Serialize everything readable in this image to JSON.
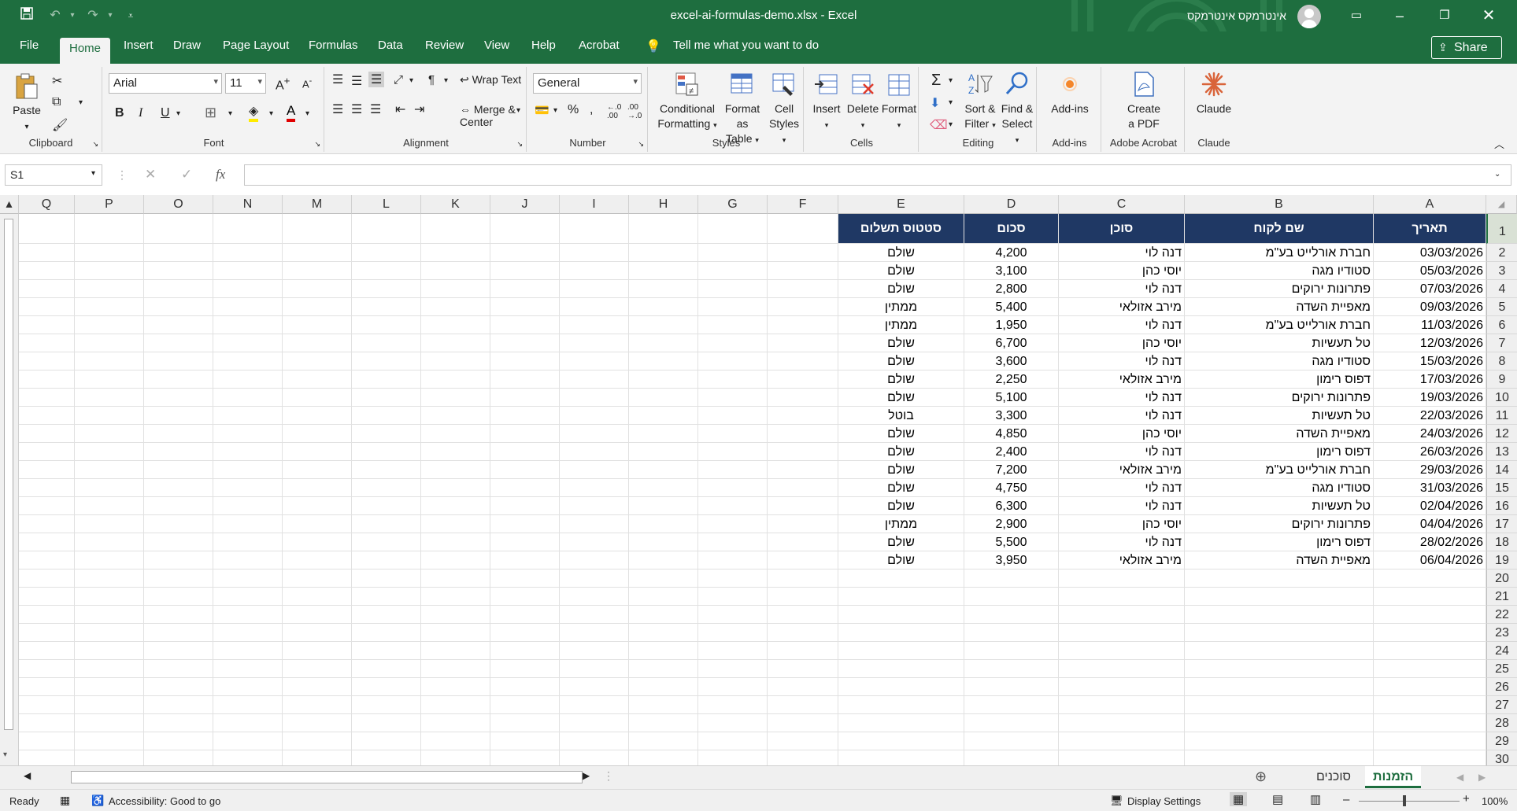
{
  "window": {
    "title": "excel-ai-formulas-demo.xlsx  -  Excel",
    "user": "אינטרמקס אינטרמקס"
  },
  "menu": {
    "file": "File",
    "home": "Home",
    "insert": "Insert",
    "draw": "Draw",
    "page_layout": "Page Layout",
    "formulas": "Formulas",
    "data": "Data",
    "review": "Review",
    "view": "View",
    "help": "Help",
    "acrobat": "Acrobat",
    "tell_me": "Tell me what you want to do",
    "share": "Share"
  },
  "ribbon": {
    "clipboard": {
      "label": "Clipboard",
      "paste": "Paste"
    },
    "font": {
      "label": "Font",
      "name": "Arial",
      "size": "11",
      "bold": "B",
      "italic": "I",
      "underline": "U"
    },
    "alignment": {
      "label": "Alignment",
      "wrap": "Wrap Text",
      "merge": "Merge & Center"
    },
    "number": {
      "label": "Number",
      "format": "General"
    },
    "styles": {
      "label": "Styles",
      "conditional_1": "Conditional",
      "conditional_2": "Formatting",
      "format_table_1": "Format as",
      "format_table_2": "Table",
      "cell_styles_1": "Cell",
      "cell_styles_2": "Styles"
    },
    "cells": {
      "label": "Cells",
      "insert": "Insert",
      "delete": "Delete",
      "format": "Format"
    },
    "editing": {
      "label": "Editing",
      "sort_1": "Sort &",
      "sort_2": "Filter",
      "find_1": "Find &",
      "find_2": "Select"
    },
    "addins": {
      "label": "Add-ins",
      "btn": "Add-ins"
    },
    "acrobat": {
      "label": "Adobe Acrobat",
      "btn_1": "Create",
      "btn_2": "a PDF"
    },
    "claude": {
      "label": "Claude",
      "btn": "Claude"
    }
  },
  "formula_bar": {
    "name_box": "S1",
    "fx": "fx",
    "formula": ""
  },
  "columns": [
    "Q",
    "P",
    "O",
    "N",
    "M",
    "L",
    "K",
    "J",
    "I",
    "H",
    "G",
    "F",
    "E",
    "D",
    "C",
    "B",
    "A"
  ],
  "header_row": {
    "date": "תאריך",
    "customer": "שם לקוח",
    "agent": "סוכן",
    "amount": "סכום",
    "status": "סטטוס תשלום"
  },
  "rows": [
    {
      "n": "2",
      "date": "03/03/2026",
      "customer": "חברת אורלייט בע\"מ",
      "agent": "דנה לוי",
      "amount": "4,200",
      "status": "שולם"
    },
    {
      "n": "3",
      "date": "05/03/2026",
      "customer": "סטודיו מגה",
      "agent": "יוסי כהן",
      "amount": "3,100",
      "status": "שולם"
    },
    {
      "n": "4",
      "date": "07/03/2026",
      "customer": "פתרונות ירוקים",
      "agent": "דנה לוי",
      "amount": "2,800",
      "status": "שולם"
    },
    {
      "n": "5",
      "date": "09/03/2026",
      "customer": "מאפיית השדה",
      "agent": "מירב אזולאי",
      "amount": "5,400",
      "status": "ממתין"
    },
    {
      "n": "6",
      "date": "11/03/2026",
      "customer": "חברת אורלייט בע\"מ",
      "agent": "דנה לוי",
      "amount": "1,950",
      "status": "ממתין"
    },
    {
      "n": "7",
      "date": "12/03/2026",
      "customer": "טל תעשיות",
      "agent": "יוסי כהן",
      "amount": "6,700",
      "status": "שולם"
    },
    {
      "n": "8",
      "date": "15/03/2026",
      "customer": "סטודיו מגה",
      "agent": "דנה לוי",
      "amount": "3,600",
      "status": "שולם"
    },
    {
      "n": "9",
      "date": "17/03/2026",
      "customer": "דפוס רימון",
      "agent": "מירב אזולאי",
      "amount": "2,250",
      "status": "שולם"
    },
    {
      "n": "10",
      "date": "19/03/2026",
      "customer": "פתרונות ירוקים",
      "agent": "דנה לוי",
      "amount": "5,100",
      "status": "שולם"
    },
    {
      "n": "11",
      "date": "22/03/2026",
      "customer": "טל תעשיות",
      "agent": "דנה לוי",
      "amount": "3,300",
      "status": "בוטל"
    },
    {
      "n": "12",
      "date": "24/03/2026",
      "customer": "מאפיית השדה",
      "agent": "יוסי כהן",
      "amount": "4,850",
      "status": "שולם"
    },
    {
      "n": "13",
      "date": "26/03/2026",
      "customer": "דפוס רימון",
      "agent": "דנה לוי",
      "amount": "2,400",
      "status": "שולם"
    },
    {
      "n": "14",
      "date": "29/03/2026",
      "customer": "חברת אורלייט בע\"מ",
      "agent": "מירב אזולאי",
      "amount": "7,200",
      "status": "שולם"
    },
    {
      "n": "15",
      "date": "31/03/2026",
      "customer": "סטודיו מגה",
      "agent": "דנה לוי",
      "amount": "4,750",
      "status": "שולם"
    },
    {
      "n": "16",
      "date": "02/04/2026",
      "customer": "טל תעשיות",
      "agent": "דנה לוי",
      "amount": "6,300",
      "status": "שולם"
    },
    {
      "n": "17",
      "date": "04/04/2026",
      "customer": "פתרונות ירוקים",
      "agent": "יוסי כהן",
      "amount": "2,900",
      "status": "ממתין"
    },
    {
      "n": "18",
      "date": "28/02/2026",
      "customer": "דפוס רימון",
      "agent": "דנה לוי",
      "amount": "5,500",
      "status": "שולם"
    },
    {
      "n": "19",
      "date": "06/04/2026",
      "customer": "מאפיית השדה",
      "agent": "מירב אזולאי",
      "amount": "3,950",
      "status": "שולם"
    }
  ],
  "empty_rows": [
    "20",
    "21",
    "22",
    "23",
    "24",
    "25",
    "26",
    "27",
    "28",
    "29",
    "30"
  ],
  "sheets": {
    "active": "הזמנות",
    "other": "סוכנים"
  },
  "status": {
    "ready": "Ready",
    "accessibility": "Accessibility: Good to go",
    "display": "Display Settings",
    "zoom": "100%"
  },
  "colors": {
    "excel_green": "#1e6e3f",
    "header_fill": "#1f3864"
  }
}
